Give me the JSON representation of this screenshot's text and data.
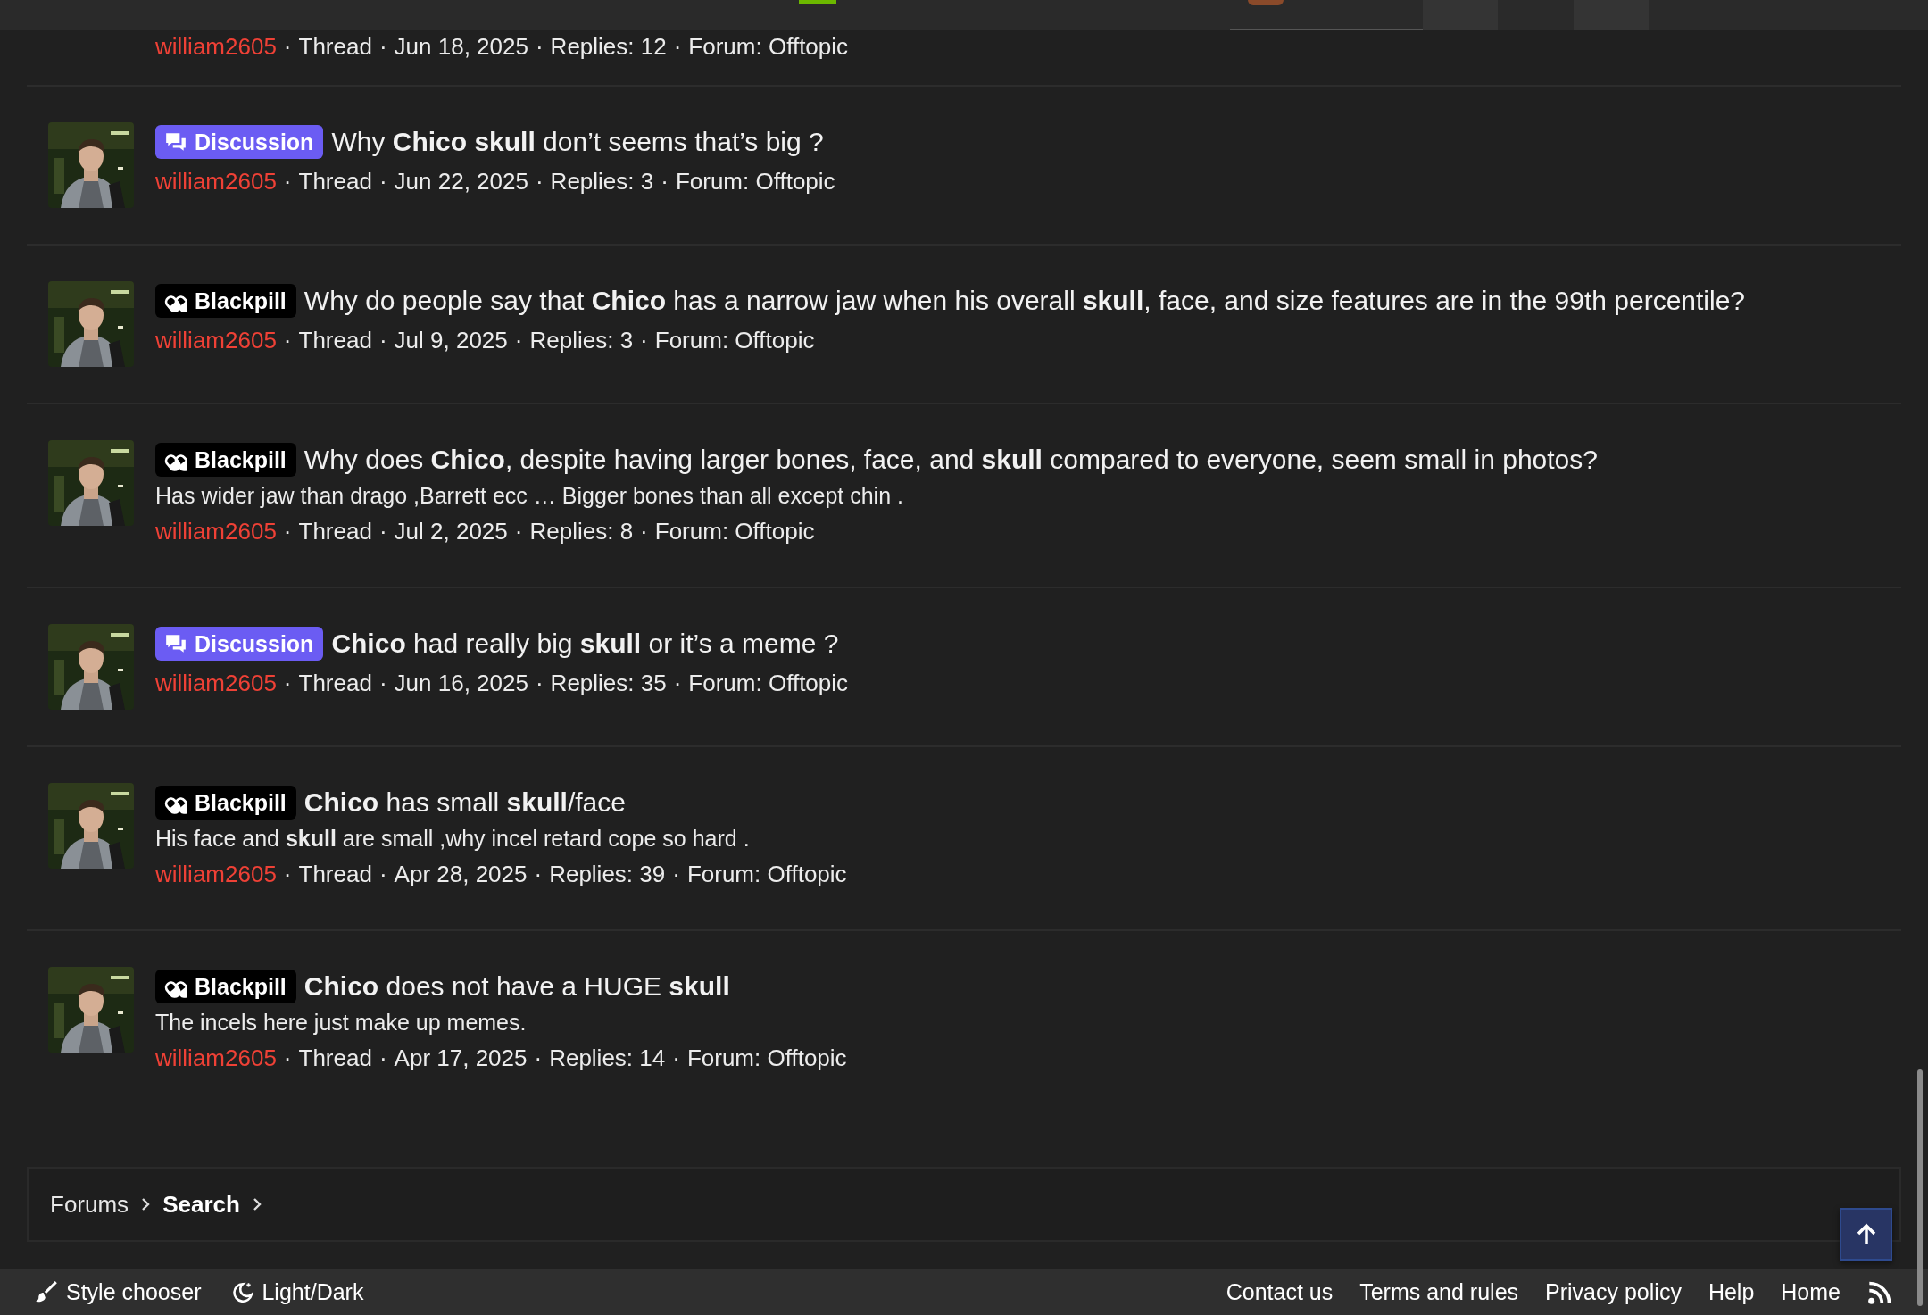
{
  "separator": "·",
  "partial_row": {
    "author": "william2605",
    "type": "Thread",
    "date": "Jun 18, 2025",
    "replies": "Replies: 12",
    "forum": "Forum: Offtopic"
  },
  "threads": [
    {
      "badge": {
        "kind": "discussion",
        "label": "Discussion"
      },
      "title": "Why **Chico skull** don’t seems that’s big ?",
      "author": "william2605",
      "type": "Thread",
      "date": "Jun 22, 2025",
      "replies": "Replies: 3",
      "forum": "Forum: Offtopic"
    },
    {
      "badge": {
        "kind": "blackpill",
        "label": "Blackpill"
      },
      "title": "Why do people say that **Chico** has a narrow jaw when his overall **skull**, face, and size features are in the 99th percentile?",
      "author": "william2605",
      "type": "Thread",
      "date": "Jul 9, 2025",
      "replies": "Replies: 3",
      "forum": "Forum: Offtopic"
    },
    {
      "badge": {
        "kind": "blackpill",
        "label": "Blackpill"
      },
      "title": "Why does **Chico**, despite having larger bones, face, and **skull** compared to everyone, seem small in photos?",
      "snippet": "Has wider jaw than drago ,Barrett ecc … Bigger bones than all except chin .",
      "author": "william2605",
      "type": "Thread",
      "date": "Jul 2, 2025",
      "replies": "Replies: 8",
      "forum": "Forum: Offtopic"
    },
    {
      "badge": {
        "kind": "discussion",
        "label": "Discussion"
      },
      "title": "**Chico** had really big **skull** or it’s a meme ?",
      "author": "william2605",
      "type": "Thread",
      "date": "Jun 16, 2025",
      "replies": "Replies: 35",
      "forum": "Forum: Offtopic"
    },
    {
      "badge": {
        "kind": "blackpill",
        "label": "Blackpill"
      },
      "title": "**Chico** has small **skull**/face",
      "snippet": "His face and **skull** are small ,why incel retard cope so hard .",
      "author": "william2605",
      "type": "Thread",
      "date": "Apr 28, 2025",
      "replies": "Replies: 39",
      "forum": "Forum: Offtopic"
    },
    {
      "badge": {
        "kind": "blackpill",
        "label": "Blackpill"
      },
      "title": "**Chico** does not have a HUGE **skull**",
      "snippet": "The incels here just make up memes.",
      "author": "william2605",
      "type": "Thread",
      "date": "Apr 17, 2025",
      "replies": "Replies: 14",
      "forum": "Forum: Offtopic"
    }
  ],
  "breadcrumb": [
    {
      "label": "Forums",
      "current": false
    },
    {
      "label": "Search",
      "current": true
    }
  ],
  "footer": {
    "left": [
      {
        "kind": "style",
        "label": "Style chooser"
      },
      {
        "kind": "theme",
        "label": "Light/Dark"
      }
    ],
    "links": [
      "Contact us",
      "Terms and rules",
      "Privacy policy",
      "Help",
      "Home"
    ]
  }
}
